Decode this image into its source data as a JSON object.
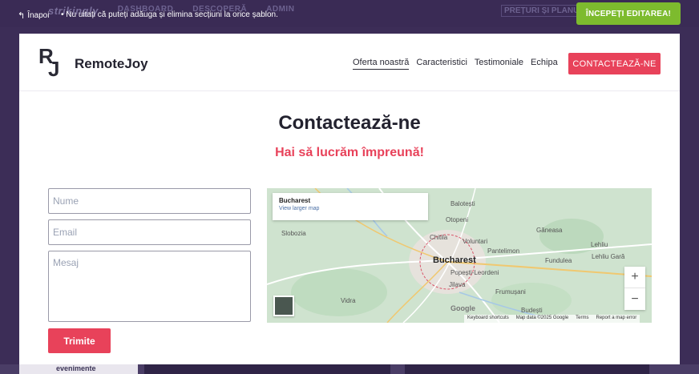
{
  "editor_bar": {
    "back_label": "Înapoi",
    "tip": "•  Nu uitați că puteți adăuga și elimina secțiuni la orice șablon.",
    "start_button": "ÎNCEPEȚI EDITAREA!",
    "bg_brand": "strikingly",
    "bg_nav": [
      "DASHBOARD",
      "DESCOPERĂ",
      "ADMIN"
    ],
    "bg_pricing": "PREȚURI ȘI PLANURI",
    "bg_events": "evenimente"
  },
  "site": {
    "logo_mark_r": "R",
    "logo_mark_j": "J",
    "logo_text": "RemoteJoy",
    "nav": [
      {
        "label": "Oferta noastră",
        "active": true
      },
      {
        "label": "Caracteristici"
      },
      {
        "label": "Testimoniale"
      },
      {
        "label": "Echipa"
      }
    ],
    "contact_button": "CONTACTEAZĂ-NE"
  },
  "contact": {
    "title": "Contactează-ne",
    "subtitle": "Hai să lucrăm împreună!",
    "name_placeholder": "Nume",
    "email_placeholder": "Email",
    "message_placeholder": "Mesaj",
    "submit_label": "Trimite"
  },
  "map": {
    "place_title": "Bucharest",
    "larger_map_link": "View larger map",
    "city_label": "Bucharest",
    "labels": [
      "Balotești",
      "Otopeni",
      "Chitila",
      "Voluntari",
      "Pantelimon",
      "Popești-Leordeni",
      "Jilava",
      "Frumușani",
      "Budești",
      "Vidra",
      "Slobozia",
      "Găneasa",
      "Lehliu",
      "Lehliu Gară",
      "Fundulea"
    ],
    "zoom_in": "+",
    "zoom_out": "−",
    "google_logo": "Google",
    "attribution": [
      "Keyboard shortcuts",
      "Map data ©2025 Google",
      "Terms",
      "Report a map error"
    ]
  }
}
